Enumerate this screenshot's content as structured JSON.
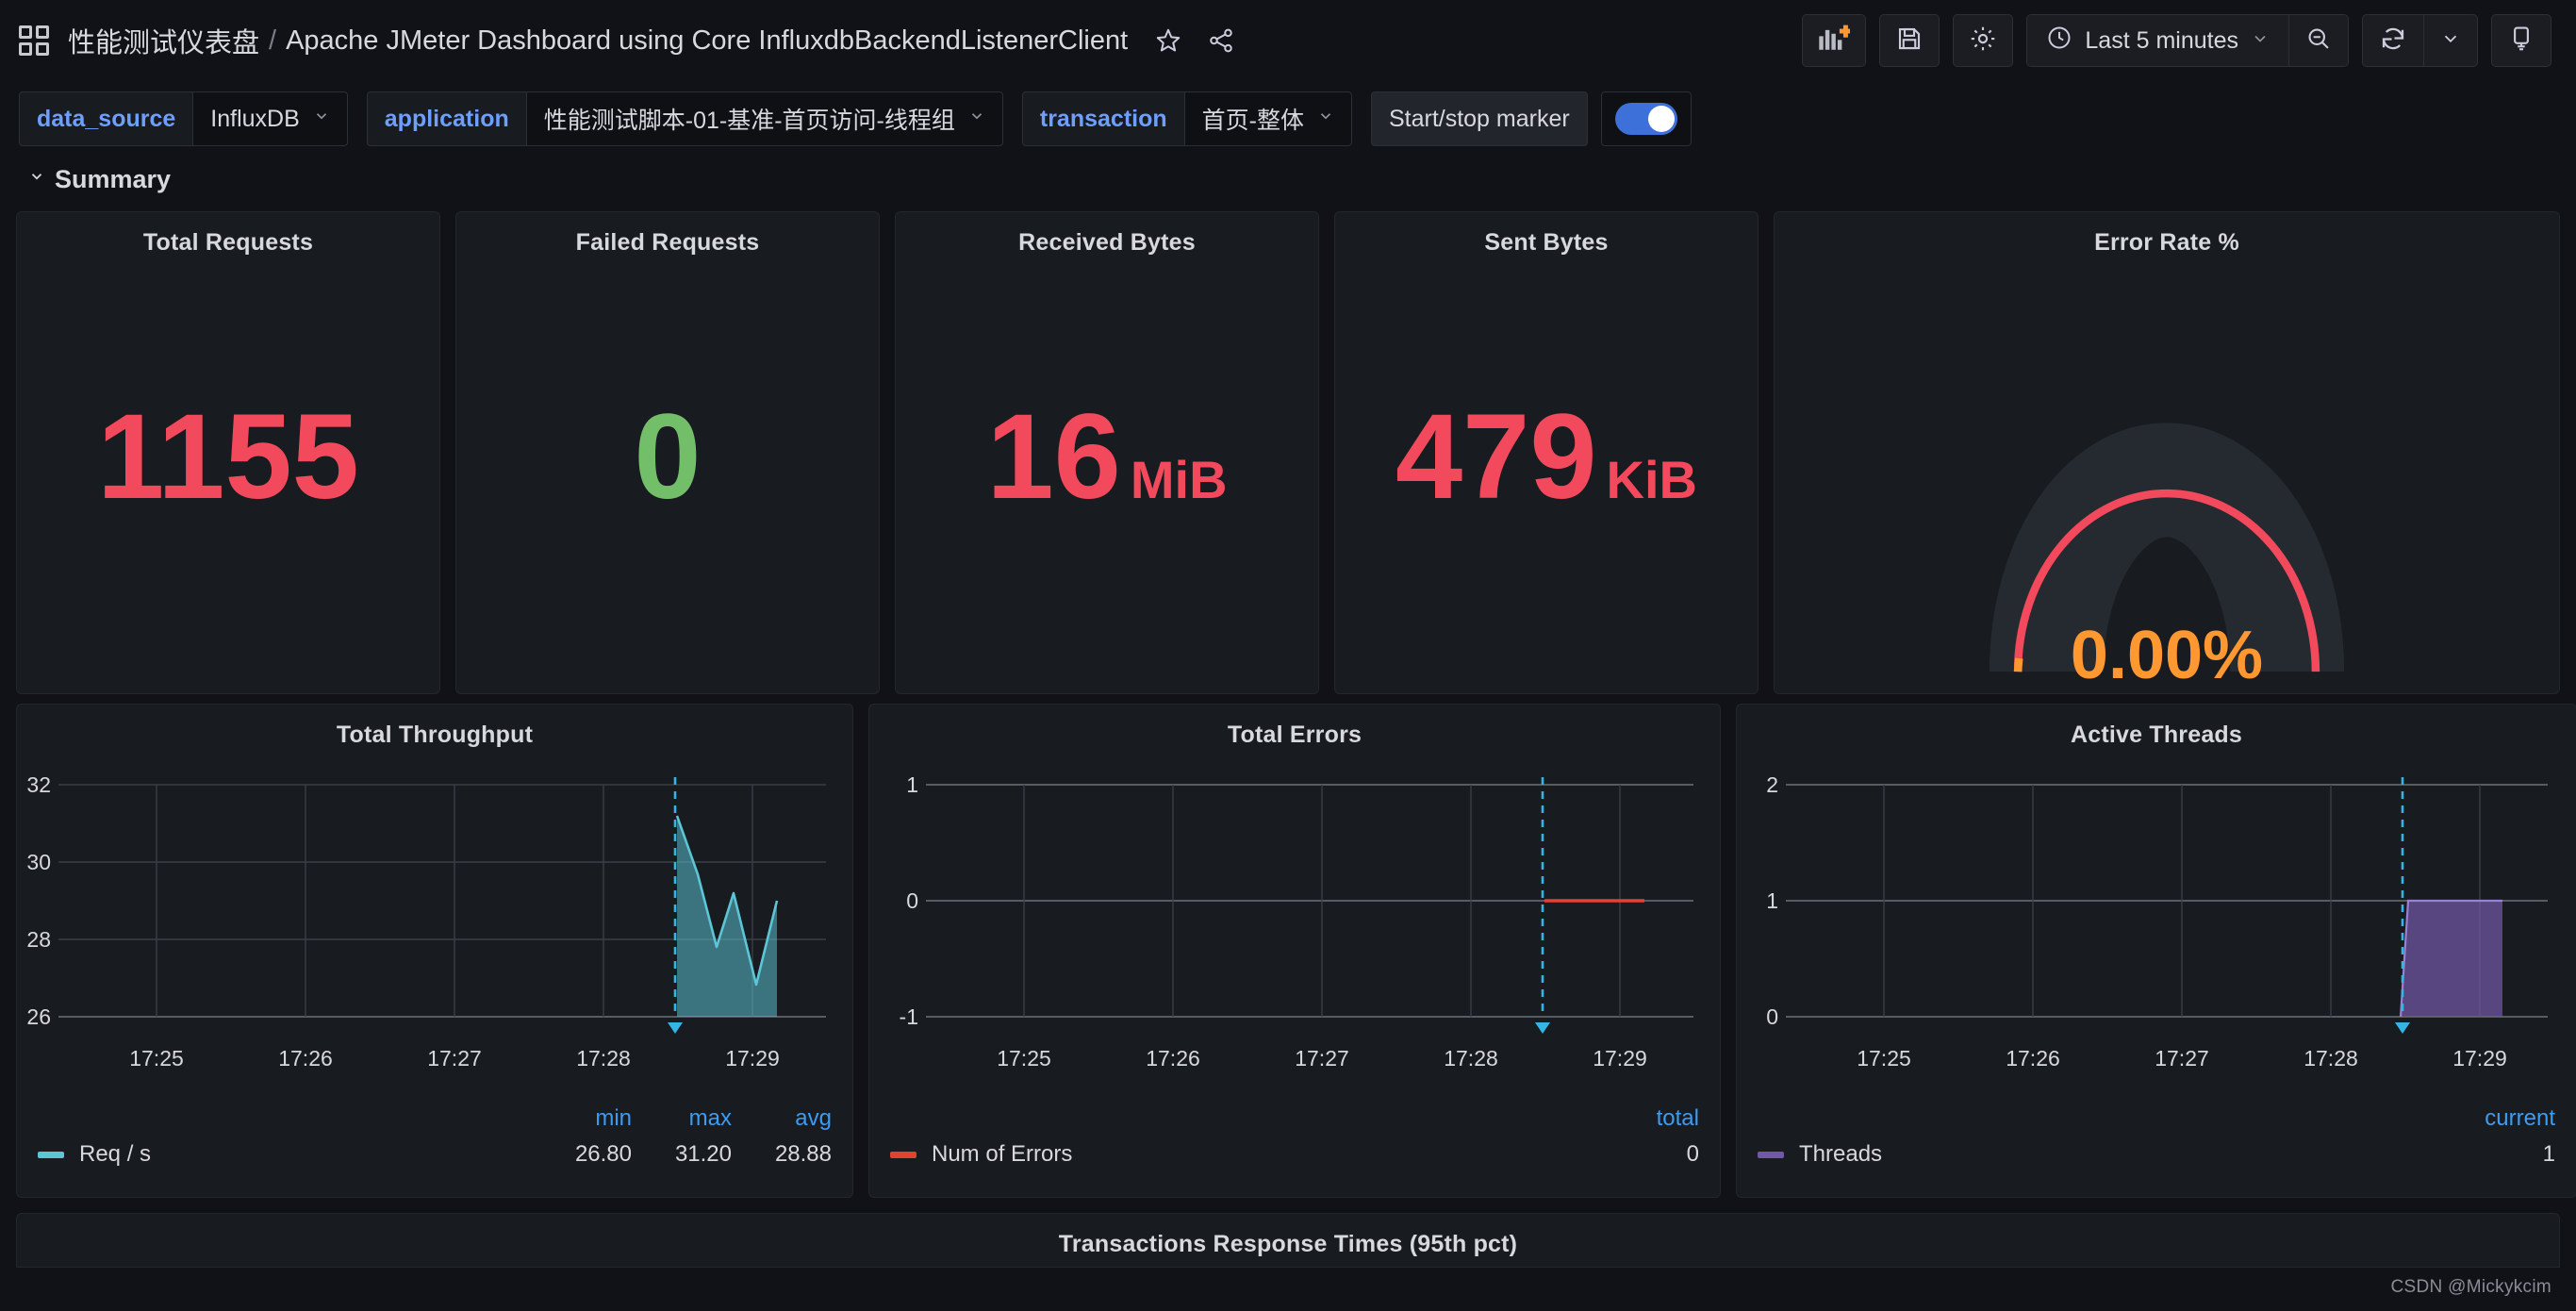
{
  "header": {
    "dashboard_icon": "grid-icon",
    "folder": "性能测试仪表盘",
    "separator": "/",
    "title": "Apache JMeter Dashboard using Core InfluxdbBackendListenerClient",
    "star_icon": "star-icon",
    "share_icon": "share-icon",
    "toolbar": {
      "add_panel_icon": "add-panel-icon",
      "save_icon": "save-icon",
      "settings_icon": "gear-icon",
      "time_clock_icon": "clock-icon",
      "time_range": "Last 5 minutes",
      "time_chevron": "chevron-down-icon",
      "zoom_out_icon": "zoom-out-icon",
      "refresh_icon": "refresh-icon",
      "refresh_chevron": "chevron-down-icon",
      "tv_icon": "tv-mode-icon"
    }
  },
  "variables": [
    {
      "label": "data_source",
      "value": "InfluxDB"
    },
    {
      "label": "application",
      "value": "性能测试脚本-01-基准-首页访问-线程组"
    },
    {
      "label": "transaction",
      "value": "首页-整体"
    }
  ],
  "marker": {
    "label": "Start/stop marker",
    "enabled": true
  },
  "row": {
    "title": "Summary",
    "collapse_icon": "chevron-down-icon"
  },
  "colors": {
    "red": "#f2495c",
    "green": "#73bf69",
    "orange": "#ff9830",
    "cyan": "#5cc5d6",
    "purple": "#7158a8",
    "error_red": "#e0432f",
    "blue_link": "#3d9bf0",
    "panel_bg": "#181b1f",
    "page_bg": "#111217"
  },
  "stats": [
    {
      "title": "Total Requests",
      "value": "1155",
      "unit": "",
      "color": "#f2495c"
    },
    {
      "title": "Failed Requests",
      "value": "0",
      "unit": "",
      "color": "#73bf69"
    },
    {
      "title": "Received Bytes",
      "value": "16",
      "unit": "MiB",
      "color": "#f2495c"
    },
    {
      "title": "Sent Bytes",
      "value": "479",
      "unit": "KiB",
      "color": "#f2495c"
    }
  ],
  "gauge": {
    "title": "Error Rate %",
    "value": "0.00%",
    "value_number": 0,
    "min": 0,
    "max": 100,
    "track_color": "#f2495c",
    "value_color": "#ff9830"
  },
  "chart_data": [
    {
      "type": "area",
      "title": "Total Throughput",
      "xlabel": "",
      "ylabel": "",
      "x_ticks": [
        "17:25",
        "17:26",
        "17:27",
        "17:28",
        "17:29"
      ],
      "ylim": [
        25.6,
        32.0
      ],
      "y_ticks": [
        26,
        28,
        30,
        32
      ],
      "grid": true,
      "legend_position": "bottom",
      "legend_columns": [
        "min",
        "max",
        "avg"
      ],
      "series": [
        {
          "name": "Req / s",
          "color": "#5cc5d6",
          "min": "26.80",
          "max": "31.20",
          "avg": "28.88",
          "x": [
            17.475,
            17.479,
            17.482,
            17.4835,
            17.4855,
            17.487
          ],
          "values": [
            31.2,
            29.05,
            27.8,
            29.8,
            26.8,
            29.4
          ]
        }
      ],
      "annotation_marker": {
        "time": "17:28:30",
        "color": "#5cc5d6",
        "style": "dashed"
      }
    },
    {
      "type": "line",
      "title": "Total Errors",
      "xlabel": "",
      "ylabel": "",
      "x_ticks": [
        "17:25",
        "17:26",
        "17:27",
        "17:28",
        "17:29"
      ],
      "ylim": [
        -1,
        1
      ],
      "y_ticks": [
        -1,
        0,
        1
      ],
      "grid": true,
      "legend_position": "bottom",
      "legend_columns": [
        "total"
      ],
      "series": [
        {
          "name": "Num of Errors",
          "color": "#e0432f",
          "total": "0",
          "values": [
            0,
            0,
            0
          ]
        }
      ],
      "annotation_marker": {
        "time": "17:28:30",
        "color": "#5cc5d6",
        "style": "dashed"
      }
    },
    {
      "type": "area",
      "title": "Active Threads",
      "xlabel": "",
      "ylabel": "",
      "x_ticks": [
        "17:25",
        "17:26",
        "17:27",
        "17:28",
        "17:29"
      ],
      "ylim": [
        0,
        2
      ],
      "y_ticks": [
        0,
        1,
        2
      ],
      "grid": true,
      "legend_position": "bottom",
      "legend_columns": [
        "current"
      ],
      "series": [
        {
          "name": "Threads",
          "color": "#7158a8",
          "current": "1",
          "values": [
            0,
            1,
            1,
            1
          ]
        }
      ],
      "annotation_marker": {
        "time": "17:28:30",
        "color": "#5cc5d6",
        "style": "dashed"
      }
    }
  ],
  "bottom_panel": {
    "title": "Transactions Response Times (95th pct)"
  },
  "watermark": "CSDN @Mickykcim"
}
